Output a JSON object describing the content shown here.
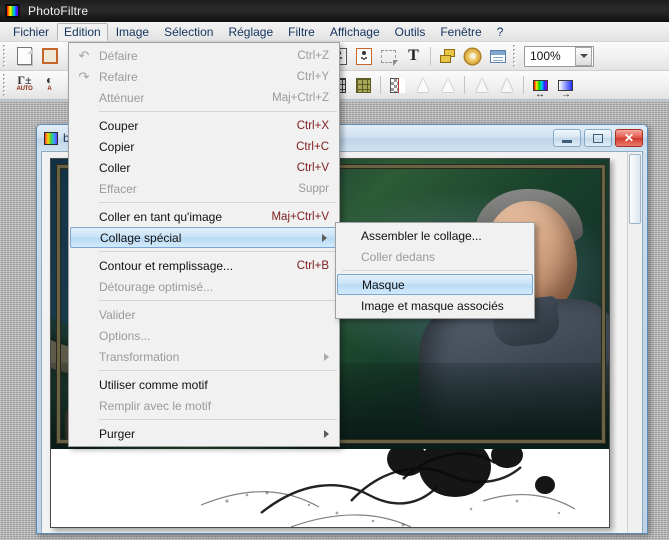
{
  "app": {
    "title": "PhotoFiltre",
    "logo_icon": "photofiltre-logo-icon"
  },
  "menubar": {
    "items": [
      {
        "label": "Fichier",
        "open": false
      },
      {
        "label": "Edition",
        "open": true
      },
      {
        "label": "Image",
        "open": false
      },
      {
        "label": "Sélection",
        "open": false
      },
      {
        "label": "Réglage",
        "open": false
      },
      {
        "label": "Filtre",
        "open": false
      },
      {
        "label": "Affichage",
        "open": false
      },
      {
        "label": "Outils",
        "open": false
      },
      {
        "label": "Fenêtre",
        "open": false
      },
      {
        "label": "?",
        "open": false
      }
    ]
  },
  "toolbar": {
    "zoom_value": "100%",
    "row1_icons": [
      "new-document-icon",
      "open-folder-icon",
      "save-icon",
      "print-icon",
      "copy-image-icon",
      "paste-image-icon",
      "selection-icon",
      "text-tool-icon",
      "layers-icon",
      "palette-icon",
      "window-icon"
    ],
    "row2_icons": [
      "auto-level-icon",
      "auto-contrast-icon",
      "text-plus-icon",
      "grid-dark-icon",
      "grid-olive-icon",
      "transparency-icon",
      "blur-drop-icon",
      "blur-drops-icon",
      "sharpen-icon",
      "sharpen-more-icon",
      "spectrum-gradient-icon",
      "blue-gradient-icon"
    ]
  },
  "image_window": {
    "title": "b",
    "icon": "image-document-icon",
    "buttons": {
      "minimize": "minimize-button",
      "maximize": "maximize-button",
      "close": "close-button"
    },
    "close_glyph": "✕"
  },
  "edition_menu": {
    "groups": [
      {
        "items": [
          {
            "label": "Défaire",
            "accel": "Ctrl+Z",
            "disabled": true,
            "icon": "undo-icon"
          },
          {
            "label": "Refaire",
            "accel": "Ctrl+Y",
            "disabled": true,
            "icon": "redo-icon"
          },
          {
            "label": "Atténuer",
            "accel": "Maj+Ctrl+Z",
            "disabled": true,
            "icon": ""
          }
        ]
      },
      {
        "items": [
          {
            "label": "Couper",
            "accel": "Ctrl+X",
            "disabled": false,
            "icon": ""
          },
          {
            "label": "Copier",
            "accel": "Ctrl+C",
            "disabled": false,
            "icon": ""
          },
          {
            "label": "Coller",
            "accel": "Ctrl+V",
            "disabled": false,
            "icon": ""
          },
          {
            "label": "Effacer",
            "accel": "Suppr",
            "disabled": true,
            "icon": ""
          }
        ]
      },
      {
        "items": [
          {
            "label": "Coller en tant qu'image",
            "accel": "Maj+Ctrl+V",
            "disabled": false,
            "icon": ""
          },
          {
            "label": "Collage spécial",
            "accel": "",
            "disabled": false,
            "submenu": true,
            "highlighted": true,
            "icon": ""
          }
        ]
      },
      {
        "items": [
          {
            "label": "Contour et remplissage...",
            "accel": "Ctrl+B",
            "disabled": false,
            "icon": ""
          },
          {
            "label": "Détourage optimisé...",
            "accel": "",
            "disabled": true,
            "icon": ""
          }
        ]
      },
      {
        "items": [
          {
            "label": "Valider",
            "accel": "",
            "disabled": true,
            "icon": ""
          },
          {
            "label": "Options...",
            "accel": "",
            "disabled": true,
            "icon": ""
          },
          {
            "label": "Transformation",
            "accel": "",
            "disabled": true,
            "submenu": true,
            "icon": ""
          }
        ]
      },
      {
        "items": [
          {
            "label": "Utiliser comme motif",
            "accel": "",
            "disabled": false,
            "icon": ""
          },
          {
            "label": "Remplir avec le motif",
            "accel": "",
            "disabled": true,
            "icon": ""
          }
        ]
      },
      {
        "items": [
          {
            "label": "Purger",
            "accel": "",
            "disabled": false,
            "submenu": true,
            "icon": ""
          }
        ]
      }
    ]
  },
  "collage_submenu": {
    "groups": [
      {
        "items": [
          {
            "label": "Assembler le collage...",
            "disabled": false,
            "highlighted": false
          },
          {
            "label": "Coller dedans",
            "disabled": true,
            "highlighted": false
          }
        ]
      },
      {
        "items": [
          {
            "label": "Masque",
            "disabled": false,
            "highlighted": true
          },
          {
            "label": "Image et masque associés",
            "disabled": false,
            "highlighted": false
          }
        ]
      }
    ]
  },
  "colors": {
    "titlebar": "#1d1d1d",
    "menu_accel": "#7d1c1c",
    "highlight_border": "#7ba7d2",
    "highlight_fill": "#c7e2f7",
    "mdi_frame": "#5b8cb8",
    "close_button": "#cf3b2e",
    "workspace": "#b4b4b4"
  }
}
